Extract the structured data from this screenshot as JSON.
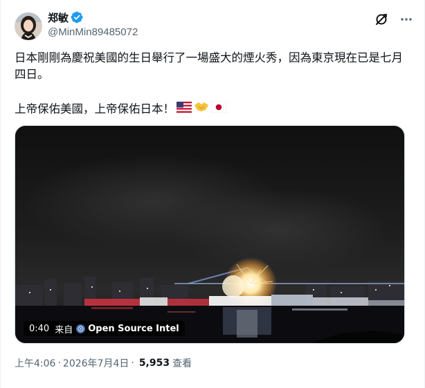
{
  "author": {
    "display_name": "郑敏",
    "handle": "@MinMin89485072",
    "verified": true
  },
  "header_actions": {
    "grok_icon": "grok-icon",
    "more_icon": "more-icon"
  },
  "tweet": {
    "text_line1": "日本剛剛為慶祝美國的生日舉行了一場盛大的煙火秀，因為東京現在已是七月四日。",
    "text_line2": "上帝保佑美國，上帝保佑日本！",
    "emojis": [
      "us-flag-emoji",
      "handshake-emoji",
      "japan-flag-emoji"
    ]
  },
  "video": {
    "duration": "0:40",
    "from_label": "来自",
    "source": "Open Source Intel"
  },
  "meta": {
    "time": "上午4:06",
    "date": "2026年7月4日",
    "views_count": "5,953",
    "views_label": "查看"
  },
  "colors": {
    "verified": "#1d9bf0",
    "secondary_text": "#536471",
    "primary_text": "#0f1419",
    "border": "#cfd9de"
  }
}
